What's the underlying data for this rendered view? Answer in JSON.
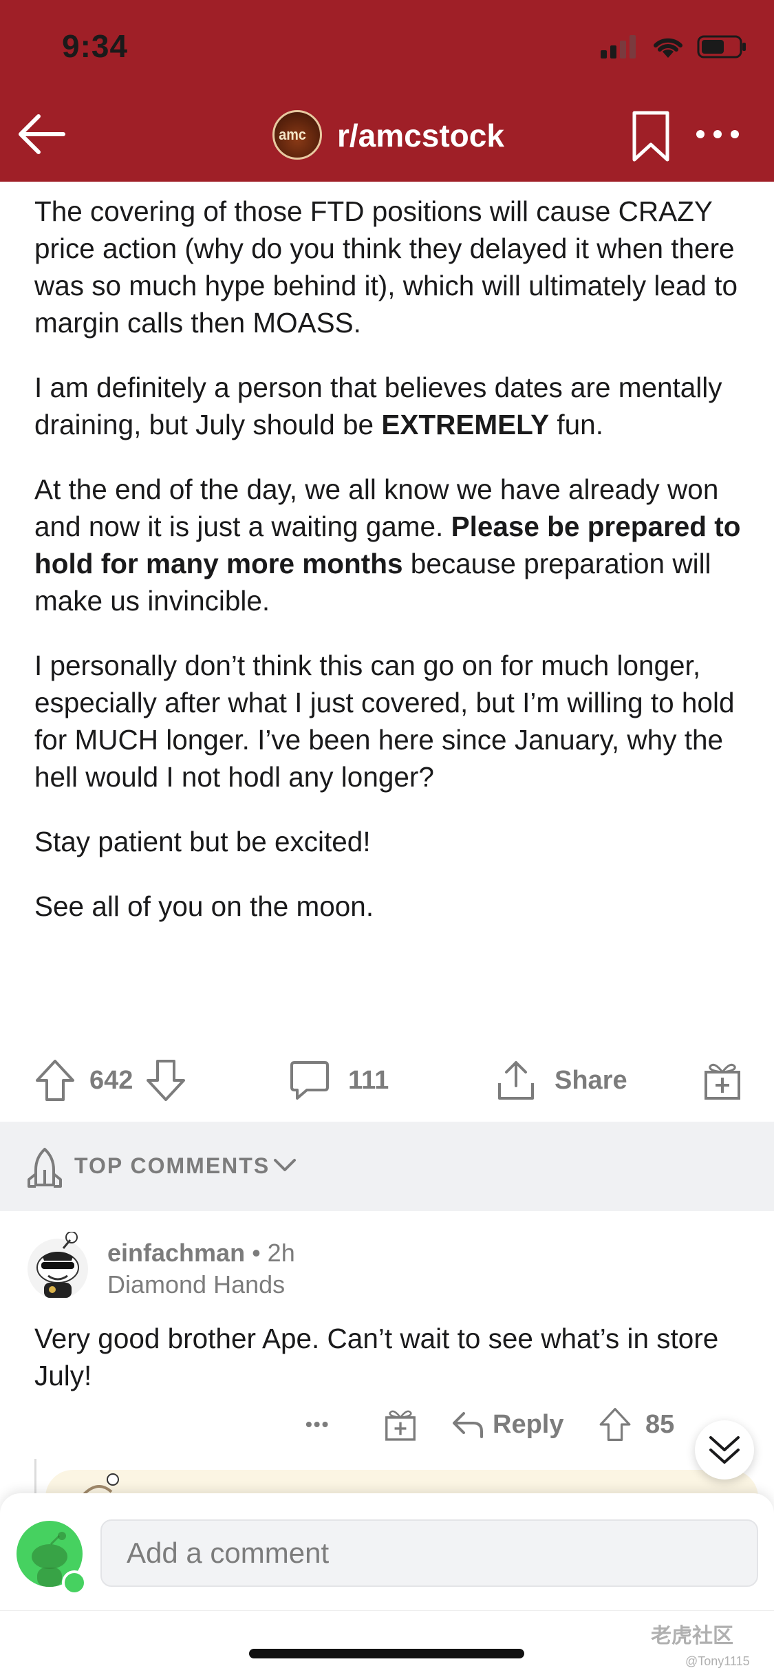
{
  "status_bar": {
    "time": "9:34"
  },
  "header": {
    "subreddit": "r/amcstock",
    "avatar_text": "amc"
  },
  "post": {
    "paragraphs": [
      {
        "text": "The covering of those FTD positions will cause CRAZY price action (why do you think they delayed it when there was so much hype behind it), which will ultimately lead to margin calls then MOASS."
      },
      {
        "pre": "I am definitely a person that believes dates are mentally draining, but July should be ",
        "bold": "EXTREMELY",
        "post": " fun."
      },
      {
        "pre": "At the end of the day, we all know we have already won and now it is just a waiting game. ",
        "bold": "Please be prepared to hold for many more months",
        "post": " because preparation will make us invincible."
      },
      {
        "text": "I personally don’t think this can go on for much longer, especially after what I just covered, but I’m willing to hold for MUCH longer. I’ve been here since January, why the hell would I not hodl any longer?"
      },
      {
        "text": "Stay patient but be excited!"
      },
      {
        "text": "See all of you on the moon."
      }
    ]
  },
  "post_actions": {
    "votes": "642",
    "comments": "111",
    "share_label": "Share"
  },
  "sort": {
    "label": "TOP COMMENTS"
  },
  "comment": {
    "username": "einfachman",
    "time": " • 2h",
    "flair": "Diamond Hands",
    "body": "Very good brother Ape. Can’t wait to see what’s in store July!",
    "more": "•••",
    "reply_label": "Reply",
    "votes": "85"
  },
  "composer": {
    "placeholder": "Add a comment"
  },
  "watermark": {
    "text": "老虎社区",
    "user": "@Tony1115"
  },
  "colors": {
    "header_bg": "#9f1f27",
    "upvote_gray": "#7c7c7c",
    "online_green": "#46d160"
  }
}
